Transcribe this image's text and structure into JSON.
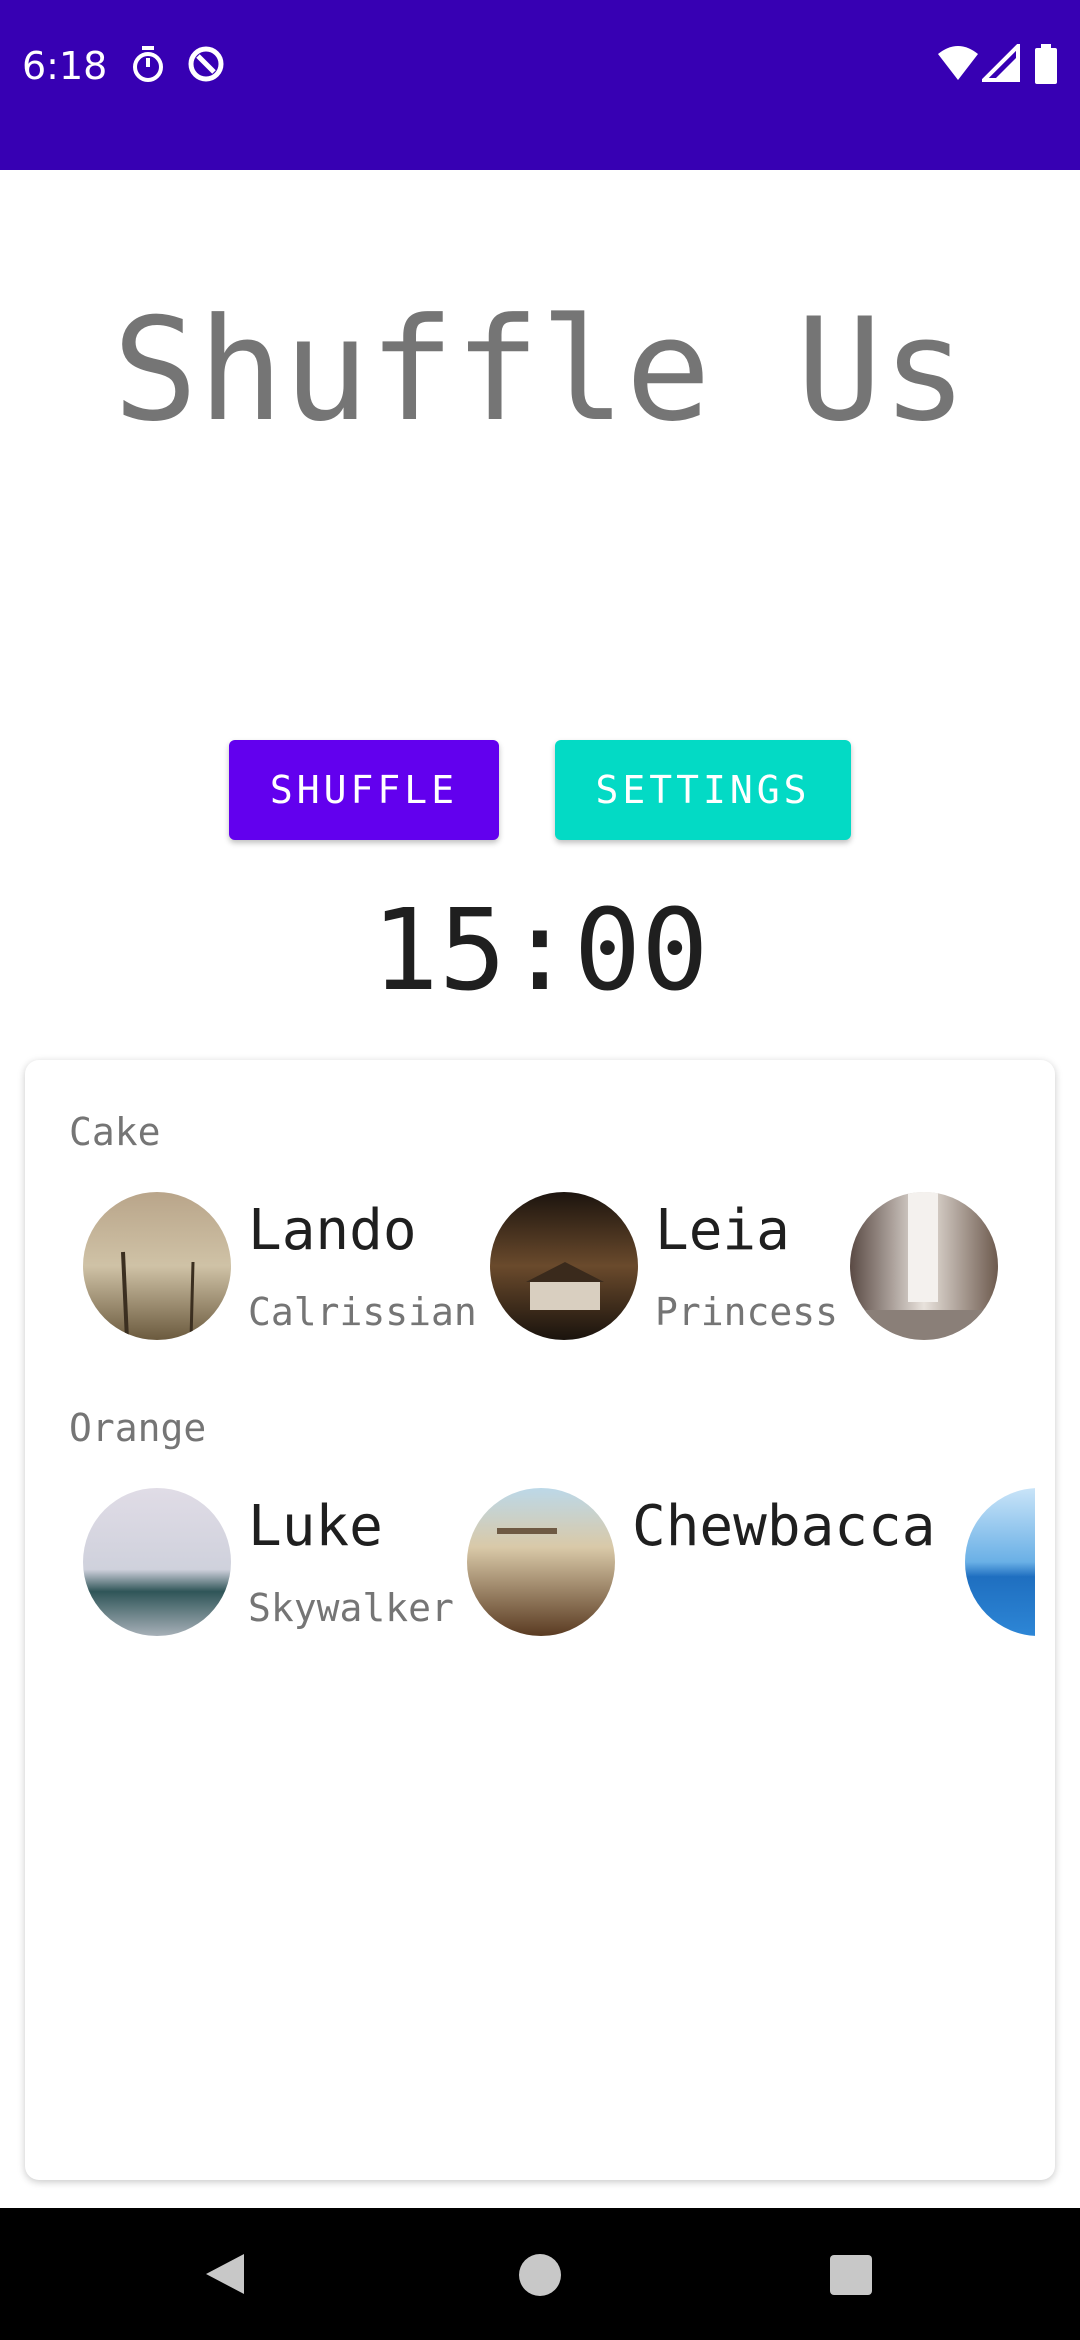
{
  "status_bar": {
    "time": "6:18",
    "icons": [
      "stopwatch-icon",
      "data-saver-icon",
      "wifi-icon",
      "cell-signal-icon",
      "battery-icon"
    ],
    "color": "#3700B3"
  },
  "app": {
    "title": "Shuffle Us",
    "shuffle_label": "SHUFFLE",
    "settings_label": "SETTINGS",
    "timer": "15:00",
    "colors": {
      "primary": "#6200EE",
      "secondary": "#03DAC5"
    }
  },
  "groups": [
    {
      "label": "Cake",
      "members": [
        {
          "name": "Lando",
          "sub": "Calrissian"
        },
        {
          "name": "Leia",
          "sub": "Princess"
        },
        {
          "name": "",
          "sub": ""
        }
      ]
    },
    {
      "label": "Orange",
      "members": [
        {
          "name": "Luke",
          "sub": "Skywalker"
        },
        {
          "name": "Chewbacca",
          "sub": ""
        },
        {
          "name": "",
          "sub": ""
        }
      ]
    }
  ],
  "nav_bar": {
    "icons": [
      "back-icon",
      "home-icon",
      "recents-icon"
    ]
  }
}
